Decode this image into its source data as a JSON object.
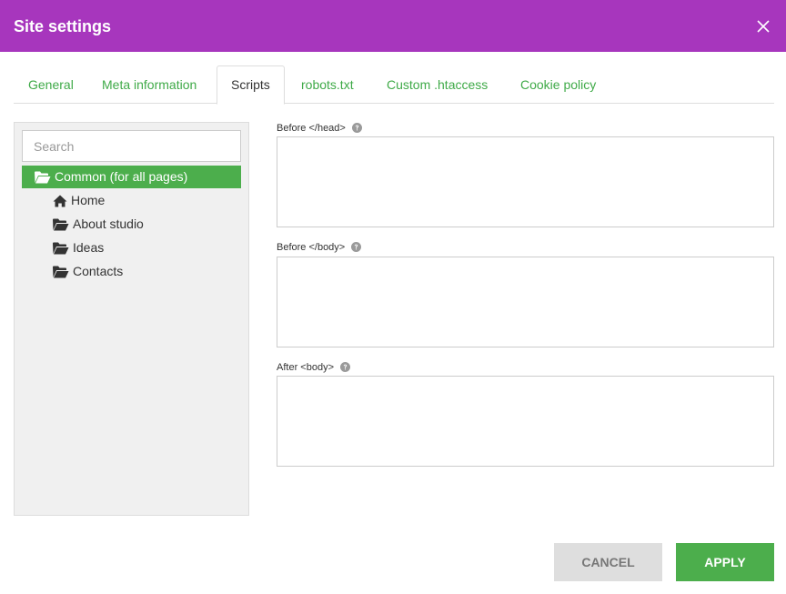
{
  "dialog": {
    "title": "Site settings"
  },
  "tabs": [
    {
      "label": "General"
    },
    {
      "label": "Meta information"
    },
    {
      "label": "Scripts",
      "active": true
    },
    {
      "label": "robots.txt"
    },
    {
      "label": "Custom .htaccess"
    },
    {
      "label": "Cookie policy"
    }
  ],
  "tree": {
    "search_placeholder": "Search",
    "root": {
      "label": "Common (for all pages)",
      "icon": "folder-open-icon"
    },
    "items": [
      {
        "label": "Home",
        "icon": "home-icon"
      },
      {
        "label": "About studio",
        "icon": "folder-open-icon"
      },
      {
        "label": "Ideas",
        "icon": "folder-open-icon"
      },
      {
        "label": "Contacts",
        "icon": "folder-open-icon"
      }
    ]
  },
  "fields": [
    {
      "label": "Before </head>",
      "value": ""
    },
    {
      "label": "Before </body>",
      "value": ""
    },
    {
      "label": "After <body>",
      "value": ""
    }
  ],
  "buttons": {
    "cancel": "CANCEL",
    "apply": "APPLY"
  },
  "colors": {
    "header": "#a736bd",
    "accent": "#4cae4c",
    "tab_link": "#3faa48"
  }
}
